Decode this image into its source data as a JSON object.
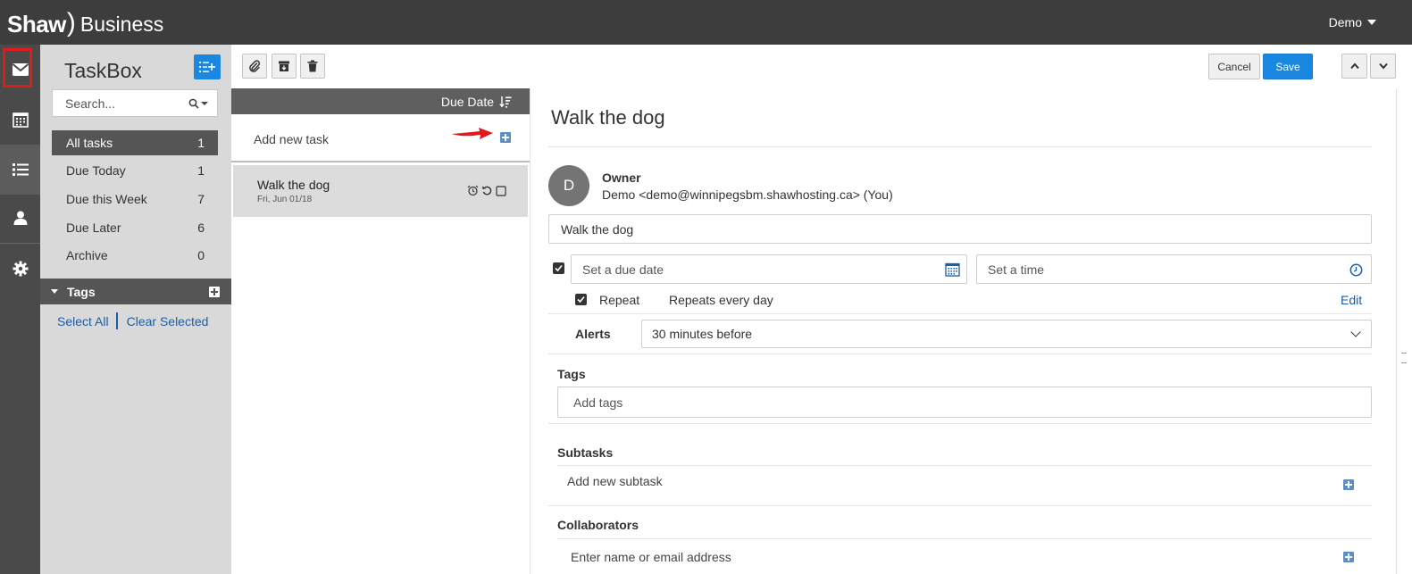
{
  "header": {
    "logo_shaw": "Shaw",
    "logo_paren": ")",
    "logo_business": "Business",
    "user": "Demo"
  },
  "rail": {
    "items": [
      "mail-icon",
      "calendar-icon",
      "tasks-list-icon",
      "contacts-icon",
      "settings-gear-icon"
    ]
  },
  "sidebar": {
    "title": "TaskBox",
    "search_placeholder": "Search...",
    "folders": [
      {
        "label": "All tasks",
        "count": "1"
      },
      {
        "label": "Due Today",
        "count": "1"
      },
      {
        "label": "Due this Week",
        "count": "7"
      },
      {
        "label": "Due Later",
        "count": "6"
      },
      {
        "label": "Archive",
        "count": "0"
      }
    ],
    "tags_header": "Tags",
    "select_all": "Select All",
    "clear_selected": "Clear Selected"
  },
  "toolbar": {
    "cancel": "Cancel",
    "save": "Save"
  },
  "tasklist": {
    "sort_label": "Due Date",
    "add_task": "Add new task",
    "items": [
      {
        "title": "Walk the dog",
        "date": "Fri, Jun 01/18"
      }
    ]
  },
  "detail": {
    "title": "Walk the dog",
    "avatar_initial": "D",
    "owner_label": "Owner",
    "owner_value": "Demo <demo@winnipegsbm.shawhosting.ca> (You)",
    "task_name": "Walk the dog",
    "due_date_placeholder": "Set a due date",
    "time_placeholder": "Set a time",
    "repeat_label": "Repeat",
    "repeat_value": "Repeats every day",
    "edit_link": "Edit",
    "alerts_label": "Alerts",
    "alerts_value": "30 minutes before",
    "tags_label": "Tags",
    "tags_placeholder": "Add tags",
    "subtasks_label": "Subtasks",
    "subtask_placeholder": "Add new subtask",
    "collaborators_label": "Collaborators",
    "collaborators_placeholder": "Enter name or email address"
  },
  "colors": {
    "topbar": "#3d3d3d",
    "accent_blue": "#1a87e0",
    "link_blue": "#1a5ea8",
    "highlight_red": "#e01b1b"
  }
}
